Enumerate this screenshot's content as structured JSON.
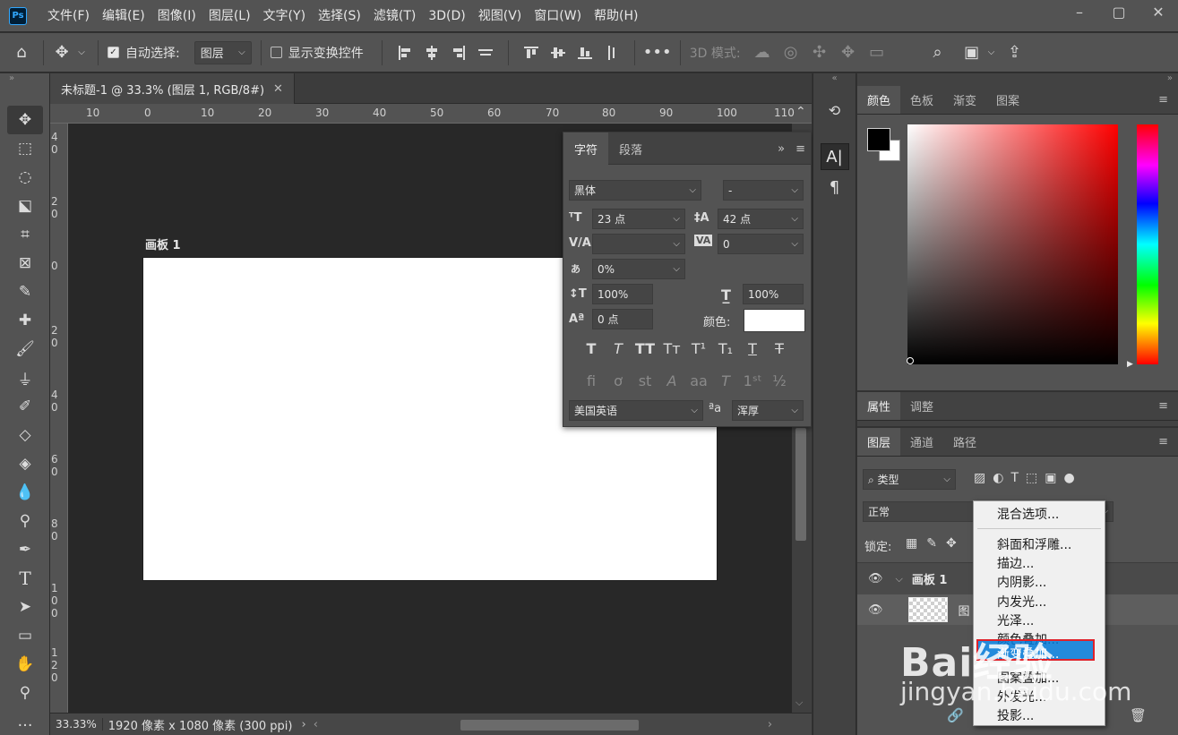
{
  "menubar": {
    "logo": "Ps",
    "items": [
      "文件(F)",
      "编辑(E)",
      "图像(I)",
      "图层(L)",
      "文字(Y)",
      "选择(S)",
      "滤镜(T)",
      "3D(D)",
      "视图(V)",
      "窗口(W)",
      "帮助(H)"
    ]
  },
  "options": {
    "auto_select_label": "自动选择:",
    "auto_select_value": "图层",
    "show_transform_label": "显示变换控件",
    "mode_3d_label": "3D 模式:"
  },
  "document": {
    "tab_title": "未标题-1 @ 33.3% (图层 1, RGB/8#)",
    "ruler_h": [
      "10",
      "0",
      "10",
      "20",
      "30",
      "40",
      "50",
      "60",
      "70",
      "80",
      "90",
      "100",
      "110"
    ],
    "ruler_v": [
      "40",
      "20",
      "0",
      "20",
      "40",
      "60",
      "80",
      "100",
      "120"
    ],
    "artboard_label": "画板 1",
    "zoom": "33.33%",
    "doc_info": "1920 像素 x 1080 像素 (300 ppi)"
  },
  "character": {
    "tab_char": "字符",
    "tab_para": "段落",
    "font_family": "黑体",
    "font_style": "-",
    "font_size": "23 点",
    "leading": "42 点",
    "kerning": "",
    "tracking": "0",
    "tsume": "0%",
    "vscale": "100%",
    "hscale": "100%",
    "baseline": "0 点",
    "color_label": "颜色:",
    "language": "美国英语",
    "aa_label": "ªa",
    "antialias": "浑厚"
  },
  "color_panel": {
    "tabs": [
      "颜色",
      "色板",
      "渐变",
      "图案"
    ],
    "fg_color": "#000000",
    "bg_color": "#ffffff"
  },
  "props_panel": {
    "tabs": [
      "属性",
      "调整"
    ]
  },
  "layers_panel": {
    "tabs": [
      "图层",
      "通道",
      "路径"
    ],
    "filter_label": "类型",
    "blend_mode": "正常",
    "lock_label": "锁定:",
    "group_name": "画板 1",
    "layer_name": "图"
  },
  "context_menu": {
    "items": [
      "混合选项...",
      "斜面和浮雕...",
      "描边...",
      "内阴影...",
      "内发光...",
      "光泽...",
      "颜色叠加...",
      "渐变叠加...",
      "图案叠加...",
      "外发光...",
      "投影..."
    ]
  },
  "watermark": {
    "text": "Bai经验",
    "sub": "jingyan.baidu.com"
  }
}
